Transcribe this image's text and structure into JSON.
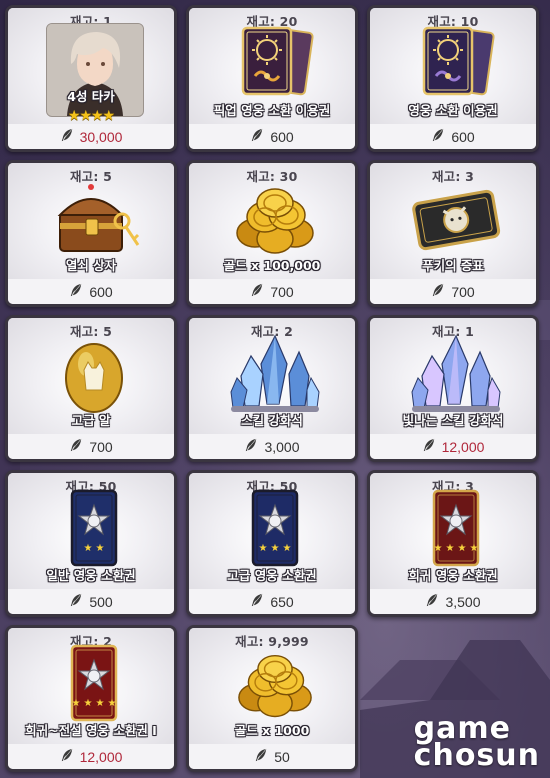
{
  "currency_icon": "feather-icon",
  "colors": {
    "price_normal": "#333333",
    "price_red": "#b0283b",
    "card_bg": "#ecebee",
    "card_border": "#3a3540"
  },
  "items": [
    {
      "stock": "재고: 1",
      "name": "4성 타카",
      "price": "30,000",
      "price_color": "red",
      "icon": "hero-portrait-icon",
      "stars": "★★★★"
    },
    {
      "stock": "재고: 20",
      "name": "픽업 영웅 소환 이용권",
      "price": "600",
      "price_color": "normal",
      "icon": "pickup-summon-ticket-icon"
    },
    {
      "stock": "재고: 10",
      "name": "영웅 소환 이용권",
      "price": "600",
      "price_color": "normal",
      "icon": "summon-ticket-icon"
    },
    {
      "stock": "재고: 5",
      "name": "열쇠 상자",
      "price": "600",
      "price_color": "normal",
      "icon": "key-chest-icon"
    },
    {
      "stock": "재고: 30",
      "name": "골드 x 100,000",
      "price": "700",
      "price_color": "normal",
      "icon": "gold-coins-icon"
    },
    {
      "stock": "재고: 3",
      "name": "푸키의 증표",
      "price": "700",
      "price_color": "normal",
      "icon": "pooky-token-icon"
    },
    {
      "stock": "재고: 5",
      "name": "고급 알",
      "price": "700",
      "price_color": "normal",
      "icon": "golden-egg-icon"
    },
    {
      "stock": "재고: 2",
      "name": "스킬 강화석",
      "price": "3,000",
      "price_color": "normal",
      "icon": "skill-crystal-icon"
    },
    {
      "stock": "재고: 1",
      "name": "빛나는 스킬 강화석",
      "price": "12,000",
      "price_color": "red",
      "icon": "shining-skill-crystal-icon"
    },
    {
      "stock": "재고: 50",
      "name": "일반 영웅 소환권",
      "price": "500",
      "price_color": "normal",
      "icon": "normal-summon-card-icon"
    },
    {
      "stock": "재고: 50",
      "name": "고급 영웅 소환권",
      "price": "650",
      "price_color": "normal",
      "icon": "advanced-summon-card-icon"
    },
    {
      "stock": "재고: 3",
      "name": "희귀 영웅 소환권",
      "price": "3,500",
      "price_color": "normal",
      "icon": "rare-summon-card-icon"
    },
    {
      "stock": "재고: 2",
      "name": "희귀~전설 영웅 소환권 I",
      "price": "12,000",
      "price_color": "red",
      "icon": "legend-summon-card-icon"
    },
    {
      "stock": "재고: 9,999",
      "name": "골드 x 1000",
      "price": "50",
      "price_color": "normal",
      "icon": "gold-coins-small-icon"
    }
  ],
  "watermark": {
    "line1": "game",
    "line2": "chosun"
  }
}
